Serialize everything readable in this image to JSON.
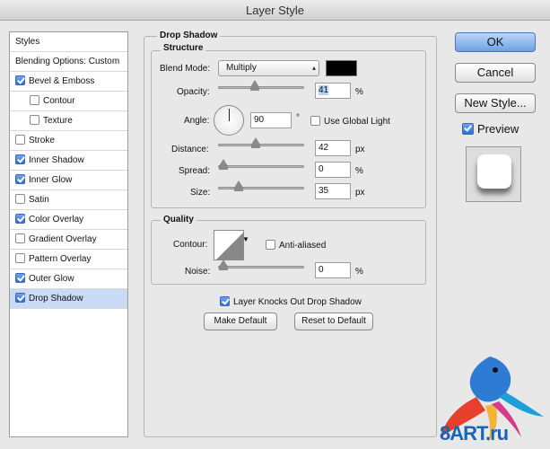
{
  "window": {
    "title": "Layer Style"
  },
  "sidebar": {
    "items": [
      {
        "label": "Styles",
        "checkbox": false,
        "checked": false,
        "indent": false,
        "selected": false
      },
      {
        "label": "Blending Options: Custom",
        "checkbox": false,
        "checked": false,
        "indent": false,
        "selected": false
      },
      {
        "label": "Bevel & Emboss",
        "checkbox": true,
        "checked": true,
        "indent": false,
        "selected": false
      },
      {
        "label": "Contour",
        "checkbox": true,
        "checked": false,
        "indent": true,
        "selected": false
      },
      {
        "label": "Texture",
        "checkbox": true,
        "checked": false,
        "indent": true,
        "selected": false
      },
      {
        "label": "Stroke",
        "checkbox": true,
        "checked": false,
        "indent": false,
        "selected": false
      },
      {
        "label": "Inner Shadow",
        "checkbox": true,
        "checked": true,
        "indent": false,
        "selected": false
      },
      {
        "label": "Inner Glow",
        "checkbox": true,
        "checked": true,
        "indent": false,
        "selected": false
      },
      {
        "label": "Satin",
        "checkbox": true,
        "checked": false,
        "indent": false,
        "selected": false
      },
      {
        "label": "Color Overlay",
        "checkbox": true,
        "checked": true,
        "indent": false,
        "selected": false
      },
      {
        "label": "Gradient Overlay",
        "checkbox": true,
        "checked": false,
        "indent": false,
        "selected": false
      },
      {
        "label": "Pattern Overlay",
        "checkbox": true,
        "checked": false,
        "indent": false,
        "selected": false
      },
      {
        "label": "Outer Glow",
        "checkbox": true,
        "checked": true,
        "indent": false,
        "selected": false
      },
      {
        "label": "Drop Shadow",
        "checkbox": true,
        "checked": true,
        "indent": false,
        "selected": true
      }
    ]
  },
  "drop_shadow": {
    "section_title": "Drop Shadow",
    "structure_title": "Structure",
    "blend_mode_label": "Blend Mode:",
    "blend_mode_value": "Multiply",
    "blend_color": "#000000",
    "opacity_label": "Opacity:",
    "opacity_value": "41",
    "opacity_unit": "%",
    "opacity_level": 0.41,
    "angle_label": "Angle:",
    "angle_value": "90",
    "angle_unit": "°",
    "use_global_light_label": "Use Global Light",
    "use_global_light_checked": false,
    "distance_label": "Distance:",
    "distance_value": "42",
    "distance_unit": "px",
    "distance_level": 0.42,
    "spread_label": "Spread:",
    "spread_value": "0",
    "spread_unit": "%",
    "spread_level": 0,
    "size_label": "Size:",
    "size_value": "35",
    "size_unit": "px",
    "size_level": 0.2,
    "quality_title": "Quality",
    "contour_label": "Contour:",
    "anti_aliased_label": "Anti-aliased",
    "anti_aliased_checked": false,
    "noise_label": "Noise:",
    "noise_value": "0",
    "noise_unit": "%",
    "noise_level": 0,
    "layer_knocks_out_label": "Layer Knocks Out Drop Shadow",
    "layer_knocks_out_checked": true,
    "make_default_label": "Make Default",
    "reset_default_label": "Reset to Default"
  },
  "actions": {
    "ok_label": "OK",
    "cancel_label": "Cancel",
    "new_style_label": "New Style...",
    "preview_label": "Preview",
    "preview_checked": true
  },
  "watermark": {
    "text": "8ART.ru"
  }
}
